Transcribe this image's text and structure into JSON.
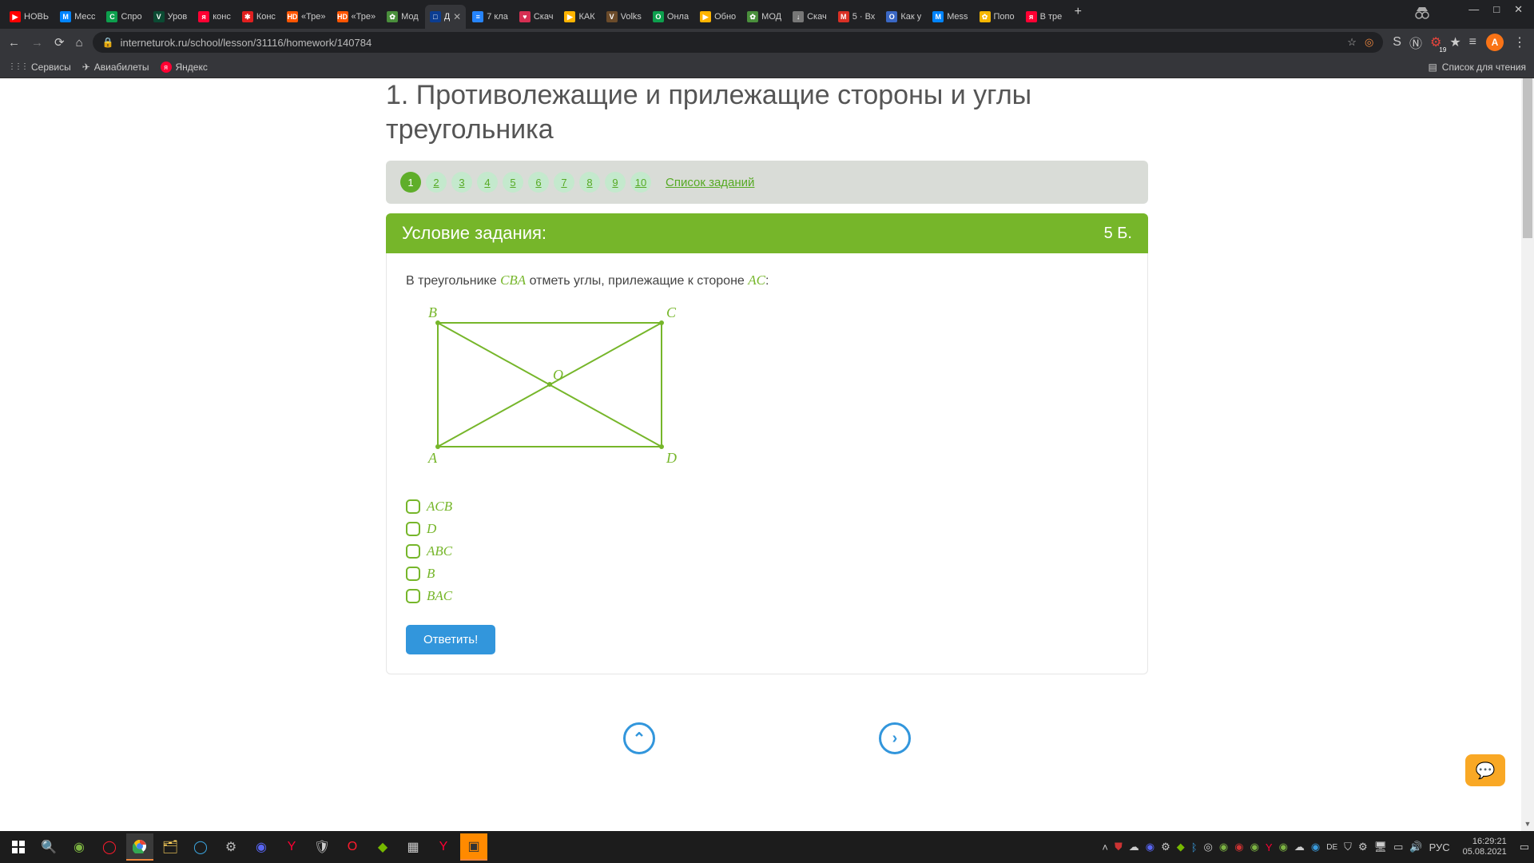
{
  "browser": {
    "tabs": [
      {
        "favicon_bg": "#ff0000",
        "favicon_text": "▶",
        "title": "НОВЬ"
      },
      {
        "favicon_bg": "#0084ff",
        "favicon_text": "M",
        "title": "Месс"
      },
      {
        "favicon_bg": "#0d9f4d",
        "favicon_text": "С",
        "title": "Спро"
      },
      {
        "favicon_bg": "#0b4b33",
        "favicon_text": "V",
        "title": "Уров"
      },
      {
        "favicon_bg": "#ff0033",
        "favicon_text": "я",
        "title": "конс"
      },
      {
        "favicon_bg": "#e01f1f",
        "favicon_text": "✱",
        "title": "Конс"
      },
      {
        "favicon_bg": "#ff5500",
        "favicon_text": "HD",
        "title": "«Тре»"
      },
      {
        "favicon_bg": "#ff5500",
        "favicon_text": "HD",
        "title": "«Тре»"
      },
      {
        "favicon_bg": "#4a8f3c",
        "favicon_text": "✿",
        "title": "Мод"
      },
      {
        "favicon_bg": "#0b3d91",
        "favicon_text": "□",
        "title": "Д",
        "active": true
      },
      {
        "favicon_bg": "#2684fc",
        "favicon_text": "≡",
        "title": "7 кла"
      },
      {
        "favicon_bg": "#d62f52",
        "favicon_text": "♥",
        "title": "Скач"
      },
      {
        "favicon_bg": "#ffb400",
        "favicon_text": "▶",
        "title": "КАК"
      },
      {
        "favicon_bg": "#6b4b2a",
        "favicon_text": "V",
        "title": "Volks"
      },
      {
        "favicon_bg": "#0d9f4d",
        "favicon_text": "О",
        "title": "Онла"
      },
      {
        "favicon_bg": "#ffb400",
        "favicon_text": "▶",
        "title": "Обно"
      },
      {
        "favicon_bg": "#4a8f3c",
        "favicon_text": "✿",
        "title": "МОД"
      },
      {
        "favicon_bg": "#777",
        "favicon_text": "↓",
        "title": "Скач"
      },
      {
        "favicon_bg": "#d93025",
        "favicon_text": "M",
        "title": "5 · Вх"
      },
      {
        "favicon_bg": "#3a67c4",
        "favicon_text": "О",
        "title": "Как у"
      },
      {
        "favicon_bg": "#0084ff",
        "favicon_text": "M",
        "title": "Mess"
      },
      {
        "favicon_bg": "#f6b600",
        "favicon_text": "✿",
        "title": "Попо"
      },
      {
        "favicon_bg": "#ff0033",
        "favicon_text": "я",
        "title": "В тре"
      }
    ],
    "newtab": "+",
    "window_min": "—",
    "window_max": "□",
    "window_close": "✕",
    "addr_url": "interneturok.ru/school/lesson/31116/homework/140784",
    "addr_star": "☆",
    "ext_icons": [
      "S",
      "Ⓝ",
      "⚙",
      "★",
      "≡"
    ],
    "avatar_letter": "А",
    "menu_dots": "⋮",
    "bookmarks": {
      "apps_icon": "⋮⋮⋮",
      "services": "Сервисы",
      "avia": "Авиабилеты",
      "yandex": "Яндекс",
      "reading_list": "Список для чтения"
    }
  },
  "page": {
    "heading": "1. Противолежащие и прилежащие стороны и углы треугольника",
    "tasks": [
      "1",
      "2",
      "3",
      "4",
      "5",
      "6",
      "7",
      "8",
      "9",
      "10"
    ],
    "task_list_link": "Список заданий",
    "condition_title": "Условие задания:",
    "points": "5 Б.",
    "task_text_prefix": "В треугольнике ",
    "task_text_math1": "CBA",
    "task_text_middle": " отметь углы, прилежащие к стороне ",
    "task_text_math2": "AC",
    "task_text_suffix": ":",
    "figure_labels": {
      "B": "B",
      "C": "C",
      "A": "A",
      "D": "D",
      "O": "O"
    },
    "options": [
      "ACB",
      "D",
      "ABC",
      "B",
      "BAC"
    ],
    "answer_button": "Ответить!",
    "nav_up": "⌃",
    "nav_right": "›"
  },
  "taskbar": {
    "lang": "РУС",
    "time": "16:29:21",
    "date": "05.08.2021"
  }
}
